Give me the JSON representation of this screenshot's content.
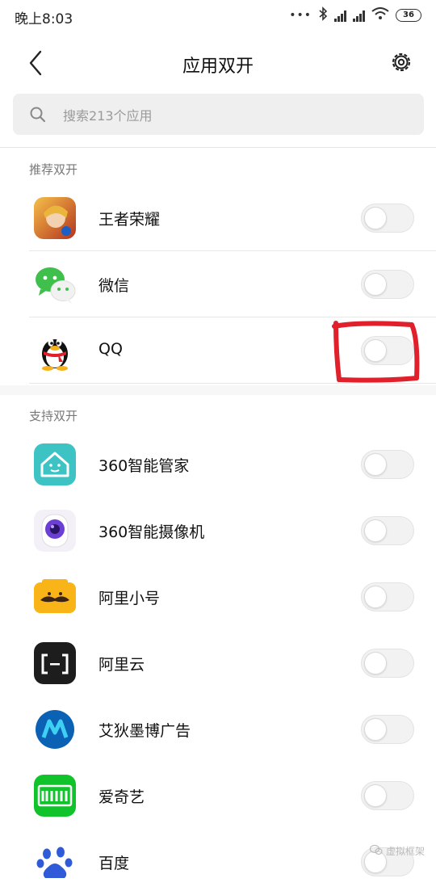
{
  "status_bar": {
    "time": "晚上8:03",
    "battery": "36"
  },
  "header": {
    "title": "应用双开"
  },
  "search": {
    "placeholder": "搜索213个应用"
  },
  "sections": {
    "recommended": "推荐双开",
    "supported": "支持双开"
  },
  "recommended_apps": [
    {
      "name": "王者荣耀",
      "icon": "honor-of-kings-icon",
      "enabled": false
    },
    {
      "name": "微信",
      "icon": "wechat-icon",
      "enabled": false
    },
    {
      "name": "QQ",
      "icon": "qq-icon",
      "enabled": false
    }
  ],
  "supported_apps": [
    {
      "name": "360智能管家",
      "icon": "360-smart-home-icon",
      "enabled": false
    },
    {
      "name": "360智能摄像机",
      "icon": "360-camera-icon",
      "enabled": false
    },
    {
      "name": "阿里小号",
      "icon": "ali-xiaohao-icon",
      "enabled": false
    },
    {
      "name": "阿里云",
      "icon": "aliyun-icon",
      "enabled": false
    },
    {
      "name": "艾狄墨博广告",
      "icon": "adwo-icon",
      "enabled": false
    },
    {
      "name": "爱奇艺",
      "icon": "iqiyi-icon",
      "enabled": false
    },
    {
      "name": "百度",
      "icon": "baidu-icon",
      "enabled": false
    }
  ],
  "watermark": "虚拟框架",
  "colors": {
    "annotation": "#e0202a",
    "toggle_off": "#f2f2f2",
    "wechat": "#3fbf4b",
    "iqiyi": "#10c32b"
  }
}
